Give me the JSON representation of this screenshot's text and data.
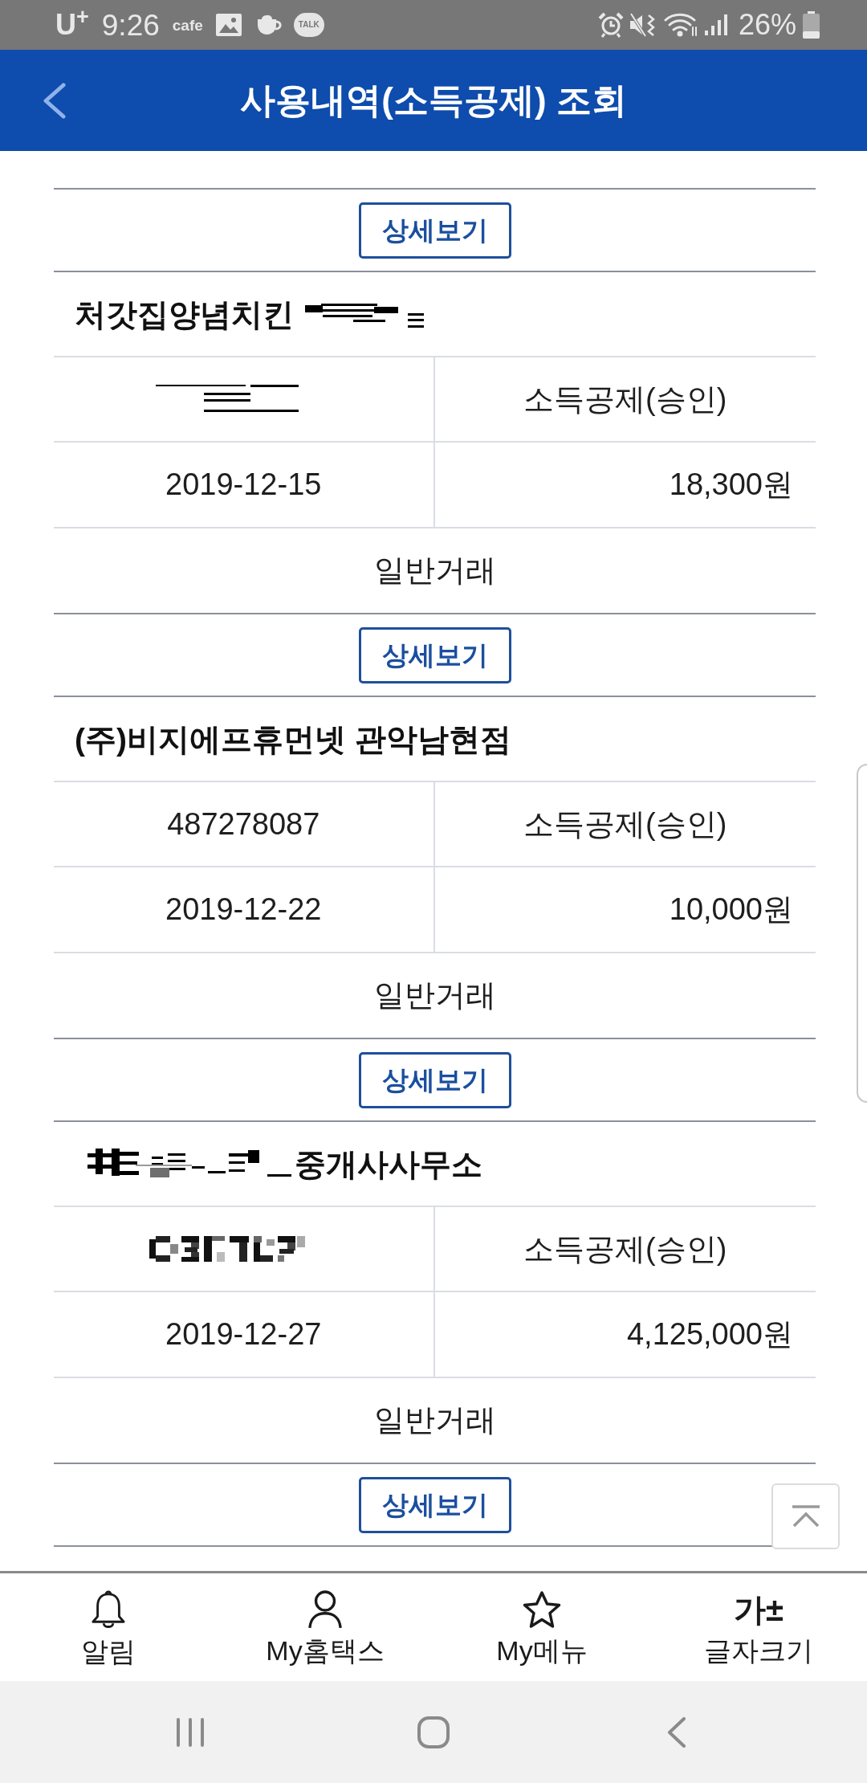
{
  "status_bar": {
    "carrier": "U$^{+}$",
    "time": "9:26",
    "app_label": "cafe",
    "chat_label": "TALK",
    "battery": "26%"
  },
  "header": {
    "title": "사용내역(소득공제) 조회"
  },
  "entries": [
    {
      "detail_button": "상세보기"
    },
    {
      "name": [
        {
          "kind": "text",
          "text": "처갓집양념치킨"
        },
        {
          "kind": "scribble"
        }
      ],
      "approval": {
        "kind": "scribble"
      },
      "deduction": "소득공제(승인)",
      "date": "2019-12-15",
      "amount": "18,300원",
      "trade_type": "일반거래",
      "detail_button": "상세보기"
    },
    {
      "name": [
        {
          "kind": "text",
          "text": "(주)비지에프휴먼넷 관악남현점"
        }
      ],
      "approval": {
        "kind": "text",
        "text": "487278087"
      },
      "deduction": "소득공제(승인)",
      "date": "2019-12-22",
      "amount": "10,000원",
      "trade_type": "일반거래",
      "detail_button": "상세보기"
    },
    {
      "name": [
        {
          "kind": "scribble"
        },
        {
          "kind": "text",
          "text": "중개사사무소"
        }
      ],
      "approval": {
        "kind": "pixelated"
      },
      "deduction": "소득공제(승인)",
      "date": "2019-12-27",
      "amount": "4,125,000원",
      "trade_type": "일반거래",
      "detail_button": "상세보기"
    }
  ],
  "bottom_nav": [
    {
      "kind": "bell",
      "label": "알림"
    },
    {
      "kind": "person",
      "label": "My홈택스"
    },
    {
      "kind": "star",
      "label": "My메뉴"
    },
    {
      "kind": "glyph",
      "glyph": "가±",
      "label": "글자크기"
    }
  ]
}
